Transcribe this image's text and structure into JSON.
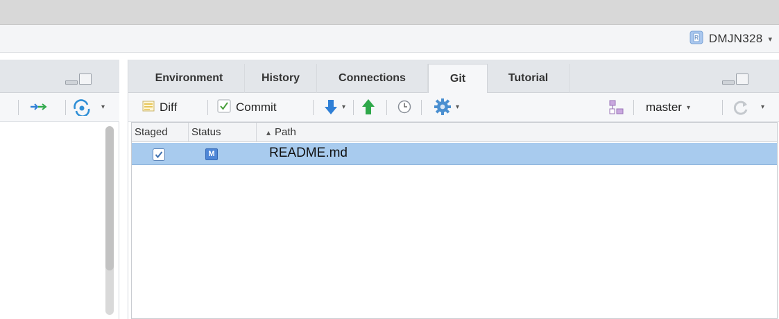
{
  "header": {
    "project_name": "DMJN328",
    "dropdown_caret": "▾"
  },
  "tabs": [
    {
      "label": "Environment",
      "active": false
    },
    {
      "label": "History",
      "active": false
    },
    {
      "label": "Connections",
      "active": false
    },
    {
      "label": "Git",
      "active": true
    },
    {
      "label": "Tutorial",
      "active": false
    }
  ],
  "toolbar": {
    "diff_label": "Diff",
    "commit_label": "Commit",
    "branch_label": "master",
    "icons": [
      "diff-icon",
      "commit-checkbox-icon",
      "pull-arrow-icon",
      "push-arrow-icon",
      "history-clock-icon",
      "gear-icon",
      "new-branch-icon",
      "refresh-icon"
    ]
  },
  "file_table": {
    "columns": [
      "Staged",
      "Status",
      "Path"
    ],
    "sort_indicator": "▴",
    "rows": [
      {
        "staged": true,
        "status": "M",
        "path": "README.md",
        "selected": true
      }
    ]
  },
  "colors": {
    "selection": "#a8cbee",
    "pull_arrow": "#2f7fd6",
    "push_arrow": "#2ea84a",
    "status_badge": "#4e86d6"
  }
}
